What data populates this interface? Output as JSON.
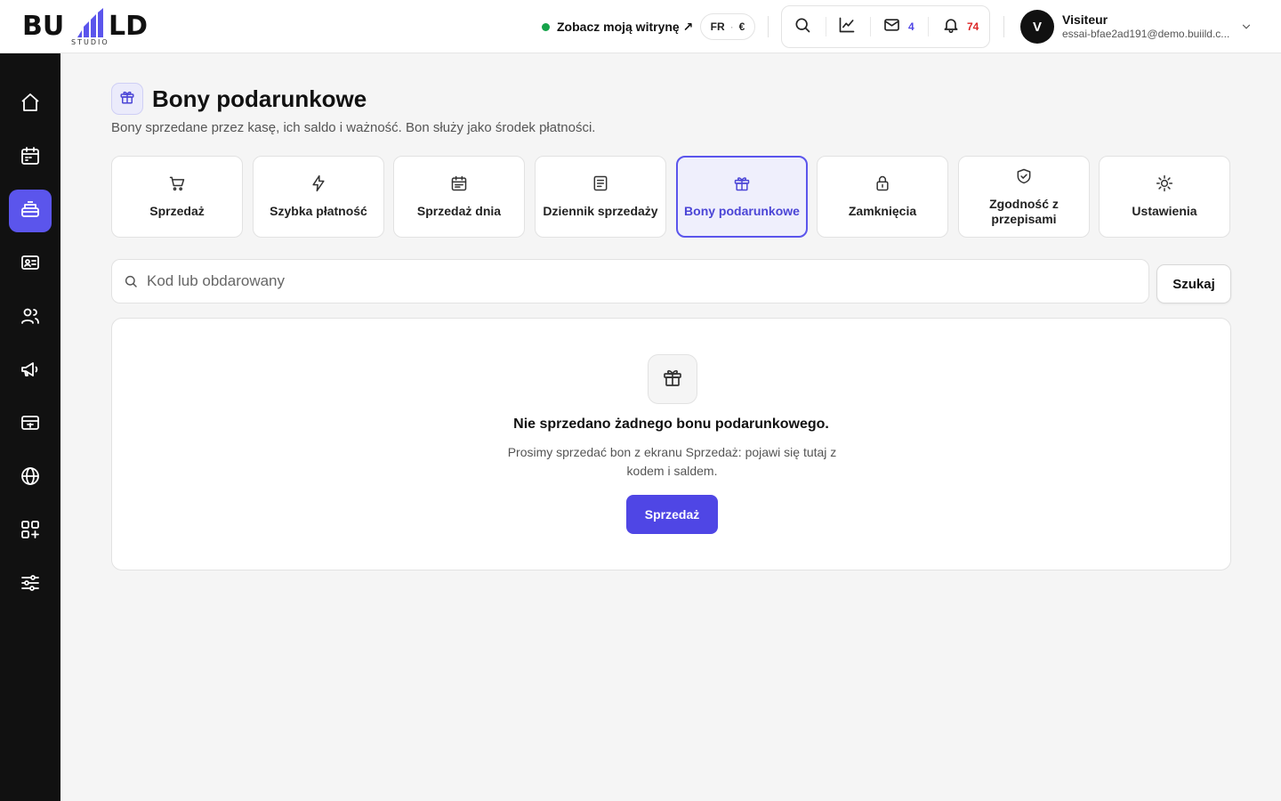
{
  "brand": {
    "logo_text_left": "BU",
    "logo_text_right": "LD",
    "logo_sub": "STUDIO",
    "accent": "#5b55ec"
  },
  "topbar": {
    "site_link": "Zobacz moją witrynę ↗",
    "lang": "FR",
    "currency": "€",
    "messages_count": "4",
    "notifications_count": "74",
    "messages_color": "#4f46e5",
    "notifications_color": "#dc2626",
    "icons": [
      "search-icon",
      "chart-icon",
      "mail-icon",
      "bell-icon"
    ],
    "user": {
      "initial": "V",
      "name": "Visiteur",
      "email": "essai-bfae2ad191@demo.buiild.c..."
    }
  },
  "sidebar": {
    "items": [
      {
        "icon": "home-icon",
        "active": false
      },
      {
        "icon": "calendar-icon",
        "active": false
      },
      {
        "icon": "register-icon",
        "active": true
      },
      {
        "icon": "contact-card-icon",
        "active": false
      },
      {
        "icon": "users-icon",
        "active": false
      },
      {
        "icon": "megaphone-icon",
        "active": false
      },
      {
        "icon": "payment-icon",
        "active": false
      },
      {
        "icon": "globe-icon",
        "active": false
      },
      {
        "icon": "apps-add-icon",
        "active": false
      },
      {
        "icon": "sliders-icon",
        "active": false
      }
    ]
  },
  "page": {
    "title": "Bony podarunkowe",
    "subtitle": "Bony sprzedane przez kasę, ich saldo i ważność. Bon służy jako środek płatności."
  },
  "tabs": [
    {
      "label": "Sprzedaż",
      "icon": "cart-icon",
      "active": false
    },
    {
      "label": "Szybka płatność",
      "icon": "lightning-icon",
      "active": false
    },
    {
      "label": "Sprzedaż dnia",
      "icon": "calendar-day-icon",
      "active": false
    },
    {
      "label": "Dziennik sprzedaży",
      "icon": "document-icon",
      "active": false
    },
    {
      "label": "Bony podarunkowe",
      "icon": "gift-icon",
      "active": true
    },
    {
      "label": "Zamknięcia",
      "icon": "lock-icon",
      "active": false
    },
    {
      "label": "Zgodność z przepisami",
      "icon": "shield-check-icon",
      "active": false
    },
    {
      "label": "Ustawienia",
      "icon": "sun-gear-icon",
      "active": false
    }
  ],
  "search": {
    "placeholder": "Kod lub obdarowany",
    "value": "",
    "button_label": "Szukaj"
  },
  "empty_state": {
    "title": "Nie sprzedano żadnego bonu podarunkowego.",
    "text": "Prosimy sprzedać bon z ekranu Sprzedaż: pojawi się tutaj z kodem i saldem.",
    "button_label": "Sprzedaż"
  }
}
